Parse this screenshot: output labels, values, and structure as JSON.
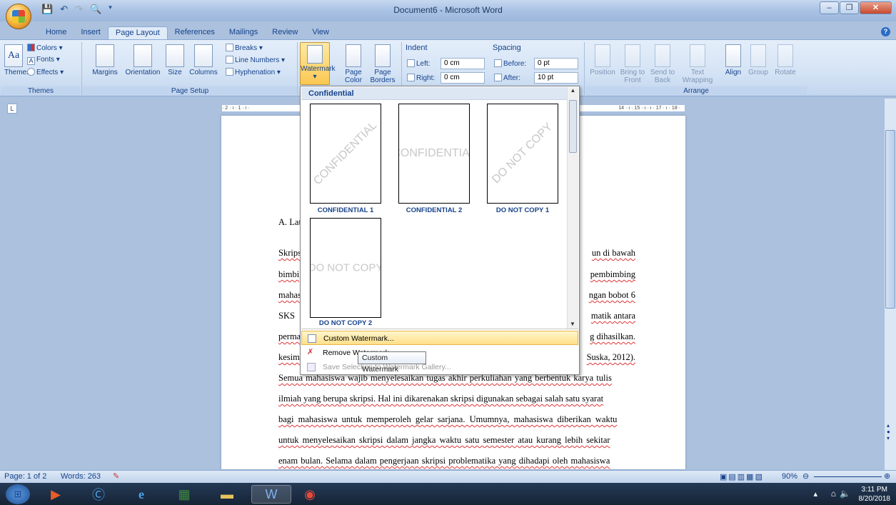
{
  "window": {
    "title": "Document6 - Microsoft Word"
  },
  "tabs": [
    "Home",
    "Insert",
    "Page Layout",
    "References",
    "Mailings",
    "Review",
    "View"
  ],
  "active_tab": "Page Layout",
  "ribbon": {
    "themes": {
      "themes_btn": "Themes",
      "colors": "Colors",
      "fonts": "Fonts",
      "effects": "Effects",
      "group": "Themes"
    },
    "page_setup": {
      "margins": "Margins",
      "orientation": "Orientation",
      "size": "Size",
      "columns": "Columns",
      "breaks": "Breaks",
      "line_numbers": "Line Numbers",
      "hyphenation": "Hyphenation",
      "group": "Page Setup"
    },
    "page_background": {
      "watermark": "Watermark",
      "page_color": "Page Color",
      "page_borders": "Page Borders"
    },
    "paragraph": {
      "indent": "Indent",
      "left": "Left:",
      "left_val": "0 cm",
      "right": "Right:",
      "right_val": "0 cm",
      "spacing": "Spacing",
      "before": "Before:",
      "before_val": "0 pt",
      "after": "After:",
      "after_val": "10 pt"
    },
    "arrange": {
      "position": "Position",
      "bring_front": "Bring to Front",
      "send_back": "Send to Back",
      "text_wrapping": "Text Wrapping",
      "align": "Align",
      "group": "Group",
      "rotate": "Rotate",
      "group_label": "Arrange"
    }
  },
  "ruler": {
    "left": "· 2 · ı · 1 · ı ·",
    "right": "14 · ı · 15 · ı · ı · 17 · ı · 18 ·"
  },
  "watermark_gallery": {
    "header": "Confidential",
    "items": [
      {
        "label": "CONFIDENTIAL 1",
        "text": "CONFIDENTIAL"
      },
      {
        "label": "CONFIDENTIAL 2",
        "text": "CONFIDENTIAL"
      },
      {
        "label": "DO NOT COPY 1",
        "text": "DO NOT COPY"
      },
      {
        "label": "DO NOT COPY 2",
        "text": "DO NOT COPY"
      }
    ],
    "menu": {
      "custom": "Custom Watermark...",
      "remove": "Remove Watermark",
      "save": "Save Selection to Watermark Gallery..."
    },
    "tooltip": "Custom Watermark"
  },
  "document": {
    "heading_frag": "A. Lat",
    "left_frags": [
      "Skrips",
      "bimbi",
      "mahas",
      "SKS",
      "perma",
      "kesim"
    ],
    "right_frags": [
      "un di bawah",
      "pembimbing",
      "ngan bobot 6",
      "matik antara",
      "g dihasilkan.",
      "Suska, 2012)."
    ],
    "full_lines": [
      "Semua mahasiswa wajib menyelesaikan tugas akhir perkuliahan yang berbentuk karya tulis",
      "ilmiah yang berupa skripsi. Hal ini dikarenakan skripsi digunakan sebagai salah satu syarat",
      "bagi mahasiswa untuk memperoleh gelar sarjana. Umumnya, mahasiswa diberikan waktu",
      "untuk menyelesaikan skripsi dalam jangka waktu satu semester atau kurang lebih sekitar",
      "enam bulan. Selama dalam pengerjaan skripsi problematika yang dihadapi oleh mahasiswa"
    ]
  },
  "status": {
    "page": "Page: 1 of 2",
    "words": "Words: 263",
    "zoom": "90%"
  },
  "taskbar": {
    "time": "3:11 PM",
    "date": "8/20/2018"
  }
}
